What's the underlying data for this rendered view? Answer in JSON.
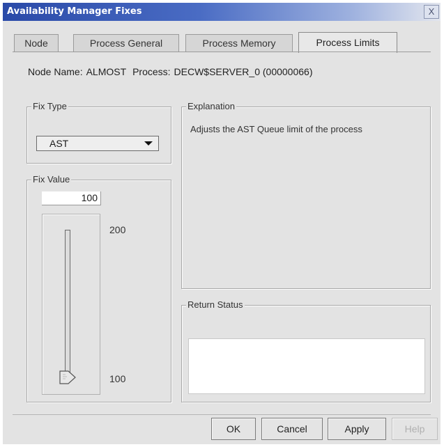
{
  "window": {
    "title": "Availability Manager Fixes",
    "close_label": "X"
  },
  "tabs": [
    {
      "label": "Node",
      "active": false
    },
    {
      "label": "Process General",
      "active": false
    },
    {
      "label": "Process Memory",
      "active": false
    },
    {
      "label": "Process Limits",
      "active": true
    }
  ],
  "info": {
    "node_label": "Node Name:",
    "node_value": "ALMOST",
    "process_label": "Process:",
    "process_value": "DECW$SERVER_0 (00000066)"
  },
  "fix_type": {
    "legend": "Fix Type",
    "selected": "AST"
  },
  "fix_value": {
    "legend": "Fix Value",
    "value": "100",
    "slider_max_label": "200",
    "slider_min_label": "100",
    "slider_min": 100,
    "slider_max": 200,
    "slider_value": 100
  },
  "explanation": {
    "legend": "Explanation",
    "text": "Adjusts the AST Queue limit of the process"
  },
  "return_status": {
    "legend": "Return Status",
    "text": ""
  },
  "buttons": {
    "ok": "OK",
    "cancel": "Cancel",
    "apply": "Apply",
    "help": "Help",
    "help_enabled": false
  }
}
